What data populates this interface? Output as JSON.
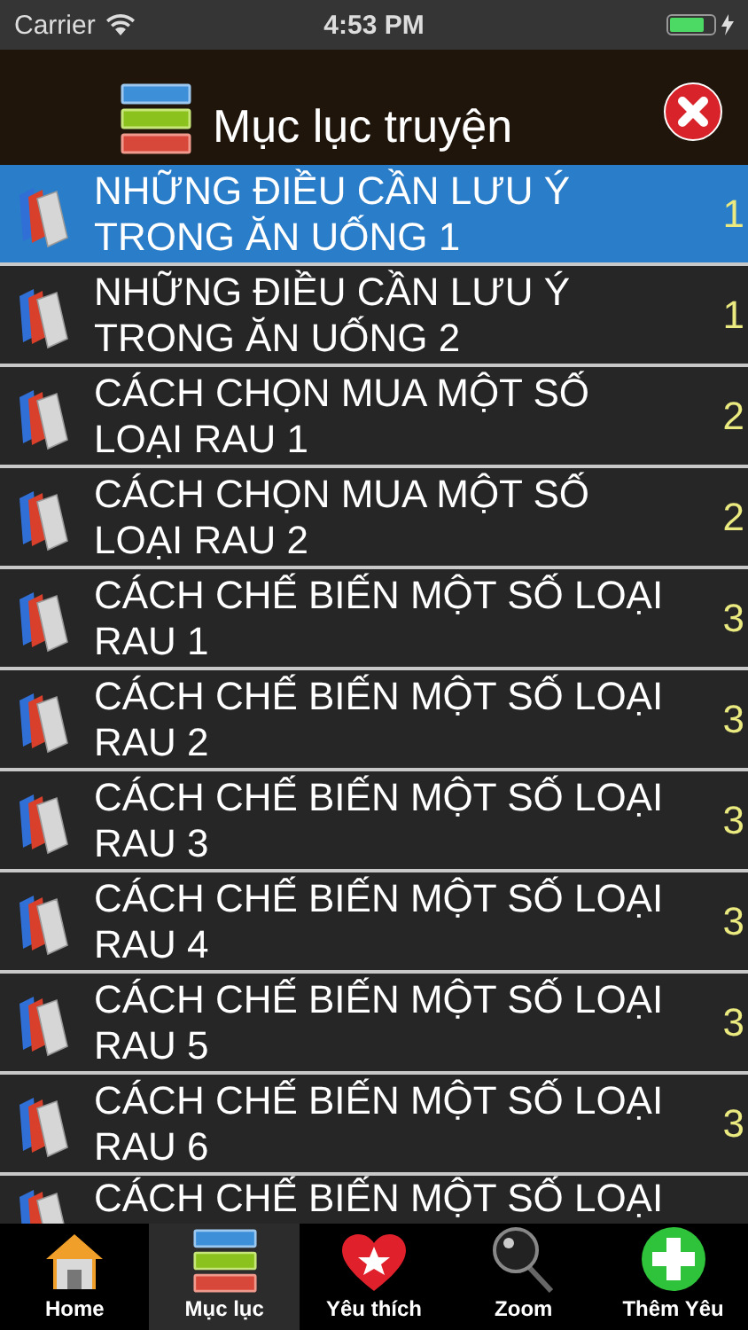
{
  "status_bar": {
    "carrier": "Carrier",
    "time": "4:53 PM"
  },
  "toc": {
    "title": "Mục lục truyện",
    "items": [
      {
        "title": "NHỮNG ĐIỀU CẦN LƯU Ý TRONG ĂN UỐNG 1",
        "page": "1",
        "selected": true
      },
      {
        "title": "NHỮNG ĐIỀU CẦN LƯU Ý TRONG ĂN UỐNG 2",
        "page": "1",
        "selected": false
      },
      {
        "title": "CÁCH CHỌN MUA MỘT SỐ LOẠI RAU 1",
        "page": "2",
        "selected": false
      },
      {
        "title": "CÁCH CHỌN MUA MỘT SỐ LOẠI RAU 2",
        "page": "2",
        "selected": false
      },
      {
        "title": "CÁCH CHẾ BIẾN MỘT SỐ LOẠI RAU 1",
        "page": "3",
        "selected": false
      },
      {
        "title": "CÁCH CHẾ BIẾN MỘT SỐ LOẠI RAU 2",
        "page": "3",
        "selected": false
      },
      {
        "title": "CÁCH CHẾ BIẾN MỘT SỐ LOẠI RAU 3",
        "page": "3",
        "selected": false
      },
      {
        "title": "CÁCH CHẾ BIẾN MỘT SỐ LOẠI RAU 4",
        "page": "3",
        "selected": false
      },
      {
        "title": "CÁCH CHẾ BIẾN MỘT SỐ LOẠI RAU 5",
        "page": "3",
        "selected": false
      },
      {
        "title": "CÁCH CHẾ BIẾN MỘT SỐ LOẠI RAU 6",
        "page": "3",
        "selected": false
      },
      {
        "title": "CÁCH CHẾ BIẾN MỘT SỐ LOẠI",
        "selected": false
      }
    ]
  },
  "tab_bar": [
    {
      "kind": "home",
      "label": "Home",
      "selected": false
    },
    {
      "kind": "toc",
      "label": "Mục lục",
      "selected": true
    },
    {
      "kind": "favorites",
      "label": "Yêu thích",
      "selected": false
    },
    {
      "kind": "zoom",
      "label": "Zoom",
      "selected": false
    },
    {
      "kind": "add",
      "label": "Thêm Yêu",
      "selected": false
    }
  ]
}
